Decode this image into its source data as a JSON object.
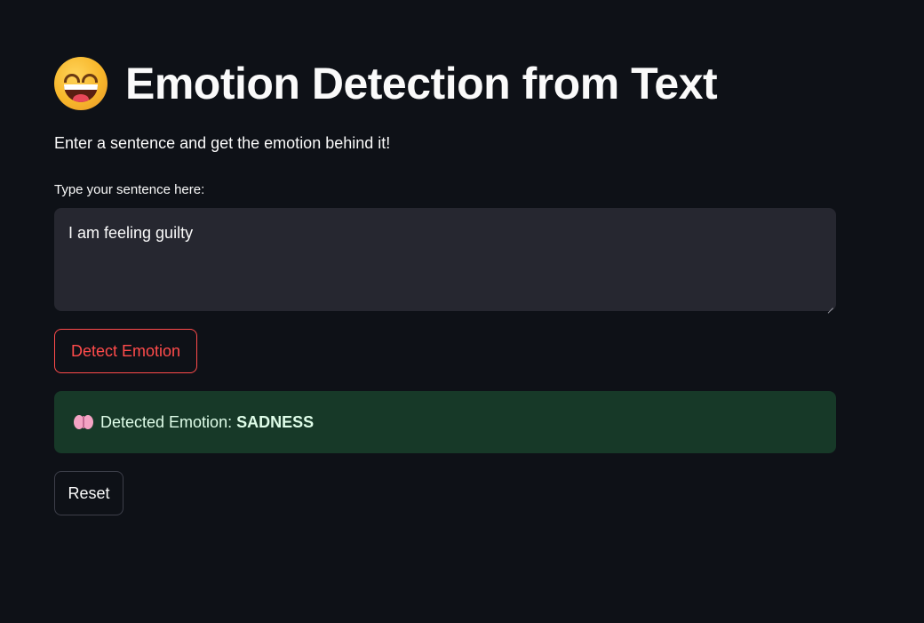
{
  "header": {
    "emoji": "grinning-face-with-big-eyes",
    "title": "Emotion Detection from Text",
    "subtitle": "Enter a sentence and get the emotion behind it!"
  },
  "input": {
    "label": "Type your sentence here:",
    "value": "I am feeling guilty",
    "placeholder": ""
  },
  "buttons": {
    "detect_label": "Detect Emotion",
    "reset_label": "Reset"
  },
  "result": {
    "icon": "brain-icon",
    "prefix": "Detected Emotion: ",
    "emotion": "SADNESS"
  },
  "colors": {
    "background": "#0e1117",
    "accent": "#ff4b4b",
    "input_bg": "#262730",
    "success_bg": "#173928",
    "success_text": "#dffde9"
  }
}
